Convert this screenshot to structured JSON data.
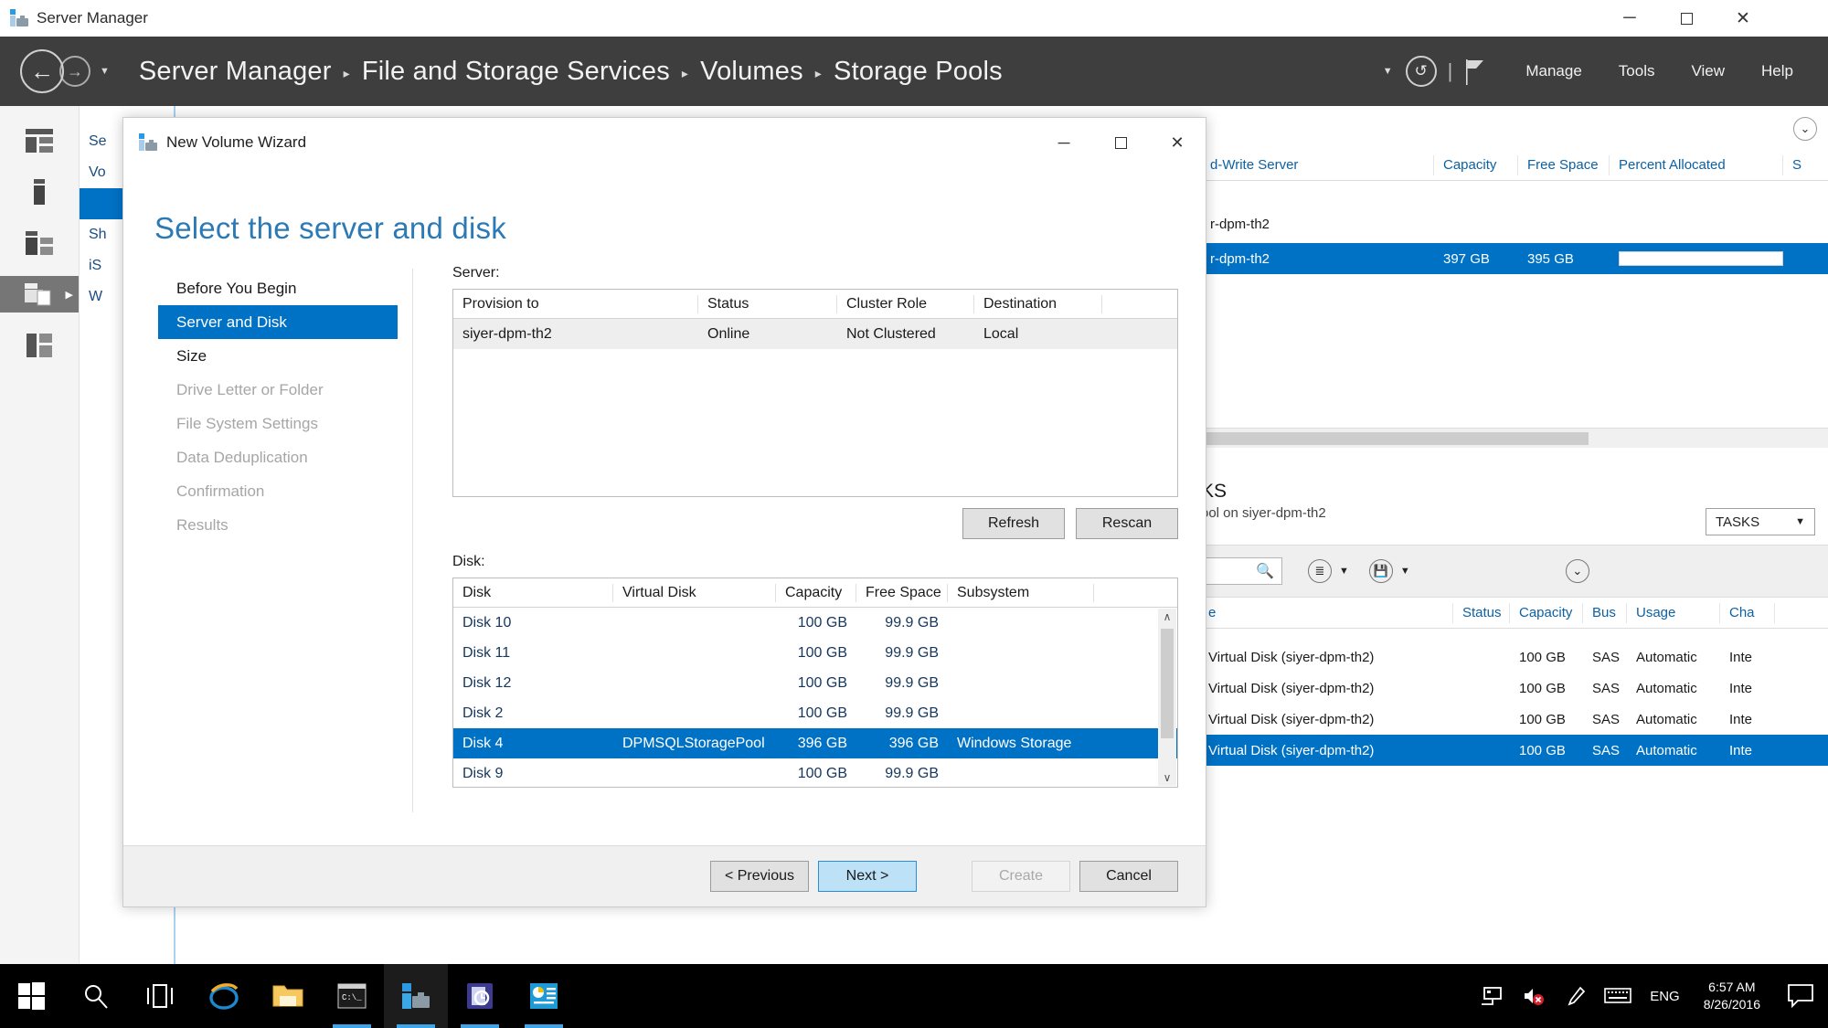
{
  "os_window": {
    "title": "Server Manager",
    "icon": "server-manager-icon",
    "minimize": "─",
    "maximize": "☐",
    "close": "✕"
  },
  "sm_header": {
    "back_icon": "back-arrow-icon",
    "forward_icon": "forward-arrow-icon",
    "dropdown_caret": "▼",
    "breadcrumb": [
      "Server Manager",
      "File and Storage Services",
      "Volumes",
      "Storage Pools"
    ],
    "separator": "▸",
    "right_caret": "▼",
    "refresh_icon": "refresh-icon",
    "pipe": "|",
    "flag_icon": "notifications-flag-icon",
    "menu": [
      "Manage",
      "Tools",
      "View",
      "Help"
    ]
  },
  "rail": {
    "items": [
      {
        "name": "dashboard-icon"
      },
      {
        "name": "local-server-icon"
      },
      {
        "name": "all-servers-icon"
      },
      {
        "name": "file-and-storage-services-icon",
        "selected": true,
        "arrow": "▶"
      },
      {
        "name": "volumes-icon"
      }
    ]
  },
  "sm_leftnav": {
    "items": [
      {
        "label": "Se",
        "selected": false
      },
      {
        "label": "Vo",
        "selected": false
      },
      {
        "label": "",
        "selected": true
      },
      {
        "label": "Sh",
        "selected": false
      },
      {
        "label": "iS",
        "selected": false
      },
      {
        "label": "W",
        "selected": false
      }
    ]
  },
  "storage_pools_panel": {
    "collapse_icon": "⌄",
    "columns": [
      "d-Write Server",
      "Capacity",
      "Free Space",
      "Percent Allocated",
      "S"
    ],
    "rows": [
      {
        "server": "r-dpm-th2",
        "capacity": "",
        "free": "",
        "percent": null,
        "s": "",
        "selected": false
      },
      {
        "server": "r-dpm-th2",
        "capacity": "397 GB",
        "free": "395 GB",
        "percent": 2,
        "s": "",
        "selected": true
      }
    ],
    "hscroll_arrow": "›"
  },
  "virtual_disks_panel": {
    "title": "KS",
    "subtitle": "ool on siyer-dpm-th2",
    "tasks_label": "TASKS",
    "tasks_caret": "▼",
    "search_icon": "search-icon",
    "search_value": "",
    "filter_icon": "filter-list-icon",
    "save_icon": "save-query-icon",
    "caret": "▼",
    "collapse_icon": "⌄",
    "columns": [
      "e",
      "Status",
      "Capacity",
      "Bus",
      "Usage",
      "Cha"
    ],
    "rows": [
      {
        "name": "Virtual Disk (siyer-dpm-th2)",
        "status": "",
        "capacity": "100 GB",
        "bus": "SAS",
        "usage": "Automatic",
        "cha": "Inte",
        "selected": false
      },
      {
        "name": "Virtual Disk (siyer-dpm-th2)",
        "status": "",
        "capacity": "100 GB",
        "bus": "SAS",
        "usage": "Automatic",
        "cha": "Inte",
        "selected": false
      },
      {
        "name": "Virtual Disk (siyer-dpm-th2)",
        "status": "",
        "capacity": "100 GB",
        "bus": "SAS",
        "usage": "Automatic",
        "cha": "Inte",
        "selected": false
      },
      {
        "name": "Virtual Disk (siyer-dpm-th2)",
        "status": "",
        "capacity": "100 GB",
        "bus": "SAS",
        "usage": "Automatic",
        "cha": "Inte",
        "selected": true
      }
    ]
  },
  "wizard": {
    "title": "New Volume Wizard",
    "title_icon": "server-manager-icon",
    "minimize": "─",
    "maximize": "☐",
    "close": "✕",
    "heading": "Select the server and disk",
    "steps": [
      {
        "label": "Before You Begin",
        "state": "done"
      },
      {
        "label": "Server and Disk",
        "state": "selected"
      },
      {
        "label": "Size",
        "state": "done"
      },
      {
        "label": "Drive Letter or Folder",
        "state": "disabled"
      },
      {
        "label": "File System Settings",
        "state": "disabled"
      },
      {
        "label": "Data Deduplication",
        "state": "disabled"
      },
      {
        "label": "Confirmation",
        "state": "disabled"
      },
      {
        "label": "Results",
        "state": "disabled"
      }
    ],
    "server_label": "Server:",
    "server_columns": [
      "Provision to",
      "Status",
      "Cluster Role",
      "Destination"
    ],
    "server_rows": [
      {
        "provision_to": "siyer-dpm-th2",
        "status": "Online",
        "cluster_role": "Not Clustered",
        "destination": "Local"
      }
    ],
    "refresh_button": "Refresh",
    "rescan_button": "Rescan",
    "disk_label": "Disk:",
    "disk_columns": [
      "Disk",
      "Virtual Disk",
      "Capacity",
      "Free Space",
      "Subsystem"
    ],
    "disk_rows": [
      {
        "disk": "Disk 10",
        "virtual_disk": "",
        "capacity": "100 GB",
        "free_space": "99.9 GB",
        "subsystem": "",
        "selected": false
      },
      {
        "disk": "Disk 11",
        "virtual_disk": "",
        "capacity": "100 GB",
        "free_space": "99.9 GB",
        "subsystem": "",
        "selected": false
      },
      {
        "disk": "Disk 12",
        "virtual_disk": "",
        "capacity": "100 GB",
        "free_space": "99.9 GB",
        "subsystem": "",
        "selected": false
      },
      {
        "disk": "Disk 2",
        "virtual_disk": "",
        "capacity": "100 GB",
        "free_space": "99.9 GB",
        "subsystem": "",
        "selected": false
      },
      {
        "disk": "Disk 4",
        "virtual_disk": "DPMSQLStoragePool",
        "capacity": "396 GB",
        "free_space": "396 GB",
        "subsystem": "Windows Storage",
        "selected": true
      },
      {
        "disk": "Disk 9",
        "virtual_disk": "",
        "capacity": "100 GB",
        "free_space": "99.9 GB",
        "subsystem": "",
        "selected": false
      }
    ],
    "scroll_up": "∧",
    "scroll_down": "∨",
    "previous_button": "< Previous",
    "next_button": "Next >",
    "create_button": "Create",
    "cancel_button": "Cancel"
  },
  "taskbar": {
    "start_icon": "windows-start-icon",
    "search_icon": "search-icon",
    "task_view_icon": "task-view-icon",
    "apps": [
      {
        "name": "internet-explorer-icon",
        "active": false,
        "running": false
      },
      {
        "name": "file-explorer-icon",
        "active": false,
        "running": false
      },
      {
        "name": "command-prompt-icon",
        "active": false,
        "running": true
      },
      {
        "name": "server-manager-icon",
        "active": true,
        "running": true
      },
      {
        "name": "dpm-console-icon",
        "active": false,
        "running": true
      },
      {
        "name": "sql-config-icon",
        "active": false,
        "running": true
      }
    ],
    "tray": [
      {
        "name": "network-icon"
      },
      {
        "name": "volume-muted-icon"
      },
      {
        "name": "pen-icon"
      },
      {
        "name": "keyboard-icon"
      }
    ],
    "language": "ENG",
    "time": "6:57 AM",
    "date": "8/26/2016",
    "action_center_icon": "action-center-icon"
  },
  "colors": {
    "accent": "#0072c6",
    "header_bg": "#3e3e3e",
    "heading_blue": "#2c7ab5",
    "link_blue": "#0b61a4"
  }
}
